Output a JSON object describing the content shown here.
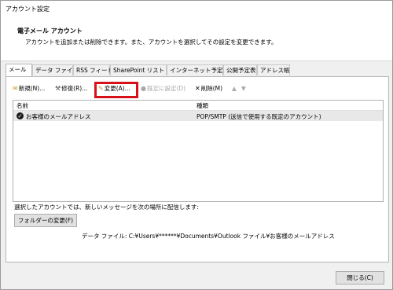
{
  "window": {
    "title": "アカウント設定"
  },
  "header": {
    "title": "電子メール アカウント",
    "description": "アカウントを追加または削除できます。また、アカウントを選択してその設定を変更できます。"
  },
  "tabs": [
    {
      "label": "メール",
      "active": true
    },
    {
      "label": "データ ファイル"
    },
    {
      "label": "RSS フィード"
    },
    {
      "label": "SharePoint リスト"
    },
    {
      "label": "インターネット予定表"
    },
    {
      "label": "公開予定表"
    },
    {
      "label": "アドレス帳"
    }
  ],
  "toolbar": {
    "new_label": "新規(N)...",
    "repair_label": "修復(R)...",
    "change_label": "変更(A)...",
    "default_label": "既定に設定(D)",
    "delete_label": "削除(M)",
    "up_icon": "arrow-up-icon",
    "down_icon": "arrow-down-icon"
  },
  "list": {
    "columns": [
      "名前",
      "種類"
    ],
    "rows": [
      {
        "name": "お客様のメールアドレス",
        "type": "POP/SMTP (送信で使用する既定のアカウント)",
        "selected": true
      }
    ]
  },
  "notice": "選択したアカウントでは、新しいメッセージを次の場所に配信します:",
  "folder_button": "フォルダーの変更(F)",
  "data_file": "データ ファイル: C:¥Users¥******¥Documents¥Outlook ファイル¥お客様のメールアドレス",
  "close_button": "閉じる(C)",
  "colors": {
    "highlight": "#d8101a",
    "selected_row": "#e8e8e8"
  }
}
